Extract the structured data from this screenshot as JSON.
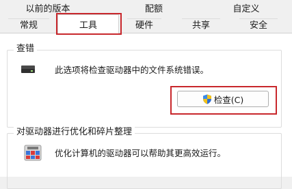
{
  "tabs_row1": [
    {
      "key": "previous_versions",
      "label": "以前的版本"
    },
    {
      "key": "quota",
      "label": "配额"
    },
    {
      "key": "customize",
      "label": "自定义"
    }
  ],
  "tabs_row2": [
    {
      "key": "general",
      "label": "常规"
    },
    {
      "key": "tools",
      "label": "工具"
    },
    {
      "key": "hardware",
      "label": "硬件"
    },
    {
      "key": "sharing",
      "label": "共享"
    },
    {
      "key": "security",
      "label": "安全"
    }
  ],
  "active_tab": "工具",
  "error_checking": {
    "title": "查错",
    "description": "此选项将检查驱动器中的文件系统错误。",
    "check_button_label": "检查(C)",
    "icon": "drive-icon"
  },
  "optimize": {
    "title": "对驱动器进行优化和碎片整理",
    "description": "优化计算机的驱动器可以帮助其更高效运行。",
    "icon": "defragment-app-icon"
  },
  "colors": {
    "highlight_border": "#c8262b",
    "panel_background": "#ffffff",
    "window_background": "#f0f0f0"
  }
}
